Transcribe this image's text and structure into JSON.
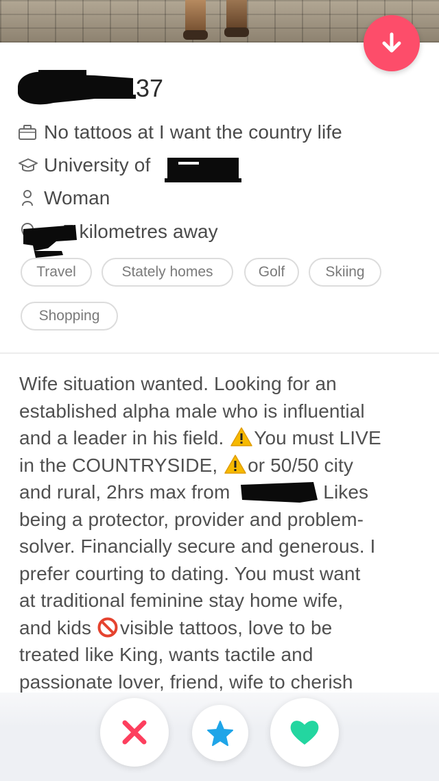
{
  "profile": {
    "age": "37",
    "job": "No tattoos at I want the country life",
    "school": "University of",
    "gender": "Woman",
    "distance": "7 kilometres away"
  },
  "interests": [
    "Travel",
    "Stately homes",
    "Golf",
    "Skiing",
    "Shopping"
  ],
  "bio": {
    "lines": [
      "Wife situation wanted. Looking for an",
      "established alpha male who is influential",
      [
        "and a leader in his field. ",
        "You must LIVE"
      ],
      [
        "in the COUNTRYSIDE, ",
        "or 50/50 city"
      ],
      [
        "and rural, 2hrs max from ",
        "Likes"
      ],
      "being a protector, provider and problem-",
      "solver. Financially secure and generous. I",
      "prefer courting to dating. You must want",
      "at traditional feminine stay home wife,",
      [
        "and kids ",
        "visible tattoos, love to be"
      ],
      "treated like King, wants tactile and",
      "passionate lover, friend, wife to cherish"
    ]
  },
  "icons": {
    "job": "briefcase-icon",
    "school": "graduation-cap-icon",
    "gender": "person-icon",
    "distance": "location-pin-icon",
    "down": "arrow-down-icon",
    "nope": "x-icon",
    "superlike": "star-icon",
    "like": "heart-icon"
  },
  "colors": {
    "down_button": "#fd4d6a",
    "nope": "#fd3f5e",
    "superlike": "#1fa5e8",
    "like": "#23d6a0"
  }
}
